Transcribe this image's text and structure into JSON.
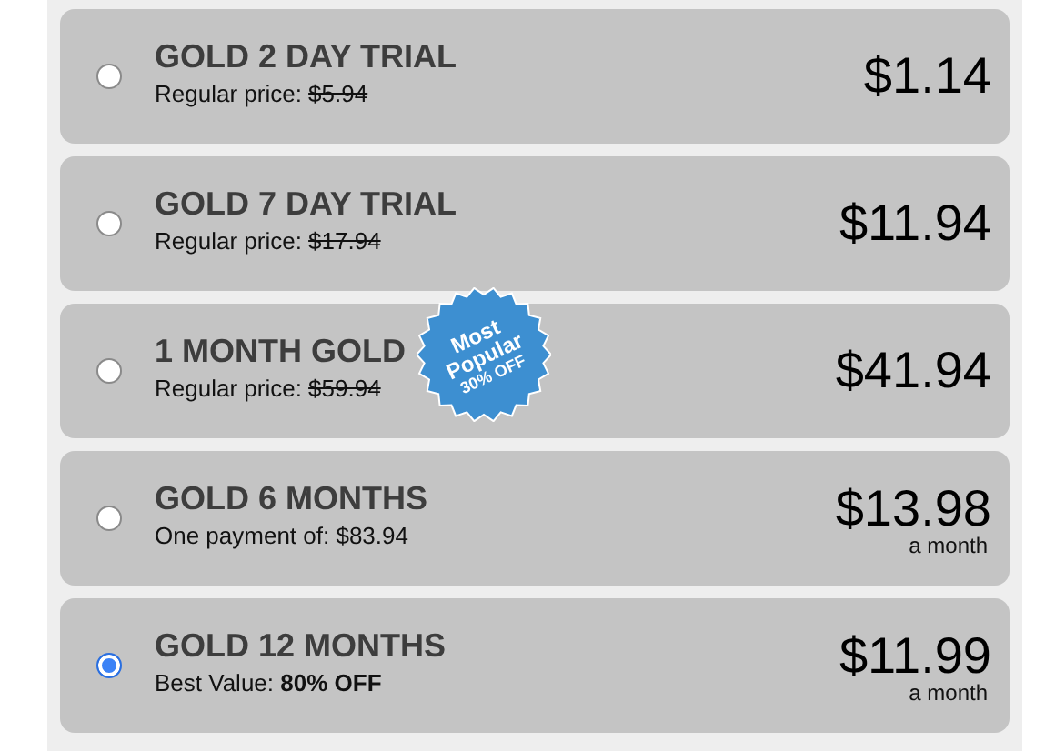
{
  "plans": [
    {
      "title": "GOLD 2 DAY TRIAL",
      "note": "Regular price: ",
      "old_price": "$5.94",
      "price": "$1.14",
      "selected": false
    },
    {
      "title": "GOLD 7 DAY TRIAL",
      "note": "Regular price: ",
      "old_price": "$17.94",
      "price": "$11.94",
      "selected": false
    },
    {
      "title": "1 MONTH GOLD",
      "note": "Regular price: ",
      "old_price": "$59.94",
      "price": "$41.94",
      "selected": false,
      "badge": [
        "Most",
        "Popular",
        "30% OFF"
      ]
    },
    {
      "title": "GOLD 6 MONTHS",
      "note": "One payment of: $83.94",
      "price": "$13.98",
      "period": "a month",
      "selected": false
    },
    {
      "title": "GOLD 12 MONTHS",
      "note": "Best Value: **80% OFF**",
      "price": "$11.99",
      "period": "a month",
      "selected": true
    }
  ]
}
